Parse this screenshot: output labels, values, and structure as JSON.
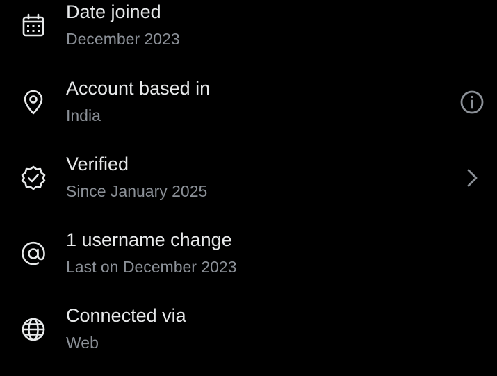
{
  "rows": [
    {
      "title": "Date joined",
      "subtitle": "December 2023",
      "icon": "calendar-icon"
    },
    {
      "title": "Account based in",
      "subtitle": "India",
      "icon": "location-pin-icon",
      "trailing_icon": "info-icon"
    },
    {
      "title": "Verified",
      "subtitle": "Since January 2025",
      "icon": "verified-badge-icon",
      "trailing_icon": "chevron-right-icon"
    },
    {
      "title": "1 username change",
      "subtitle": "Last on December 2023",
      "icon": "at-sign-icon"
    },
    {
      "title": "Connected via",
      "subtitle": "Web",
      "icon": "globe-icon"
    }
  ],
  "colors": {
    "background": "#000000",
    "primary_text": "#e7e9ea",
    "secondary_text": "#8b9097",
    "trailing_icon": "#8b9097"
  }
}
